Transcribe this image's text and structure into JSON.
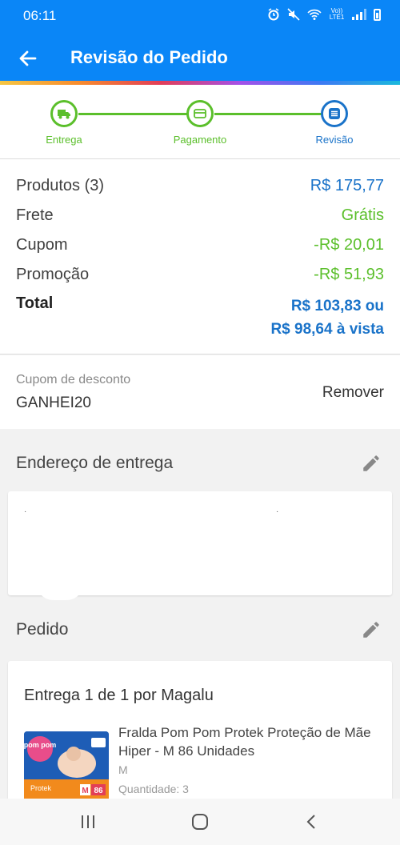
{
  "status_bar": {
    "time": "06:11",
    "network": "Vo)) LTE1"
  },
  "header": {
    "title": "Revisão do Pedido"
  },
  "steps": [
    {
      "label": "Entrega",
      "icon": "truck-icon",
      "state": "done"
    },
    {
      "label": "Pagamento",
      "icon": "card-icon",
      "state": "done"
    },
    {
      "label": "Revisão",
      "icon": "list-icon",
      "state": "current"
    }
  ],
  "summary": {
    "products_label": "Produtos (3)",
    "products_value": "R$ 175,77",
    "shipping_label": "Frete",
    "shipping_value": "Grátis",
    "coupon_label": "Cupom",
    "coupon_value": "-R$ 20,01",
    "promo_label": "Promoção",
    "promo_value": "-R$ 51,93",
    "total_label": "Total",
    "total_value": "R$ 103,83 ou",
    "total_cash": "R$ 98,64 à vista"
  },
  "coupon": {
    "label": "Cupom de desconto",
    "code": "GANHEI20",
    "remove_label": "Remover"
  },
  "address": {
    "title": "Endereço de entrega"
  },
  "order": {
    "title": "Pedido",
    "delivery_heading": "Entrega 1 de 1 por Magalu",
    "product": {
      "name": "Fralda Pom Pom Protek Proteção de Mãe Hiper - M 86 Unidades",
      "size": "M",
      "quantity": "Quantidade:  3",
      "image_text": {
        "brand": "pom pom",
        "line": "Protek",
        "size": "M",
        "count": "86"
      }
    }
  },
  "colors": {
    "primary": "#0a86f7",
    "green": "#5bbf2b",
    "blue_text": "#1a73c9"
  }
}
